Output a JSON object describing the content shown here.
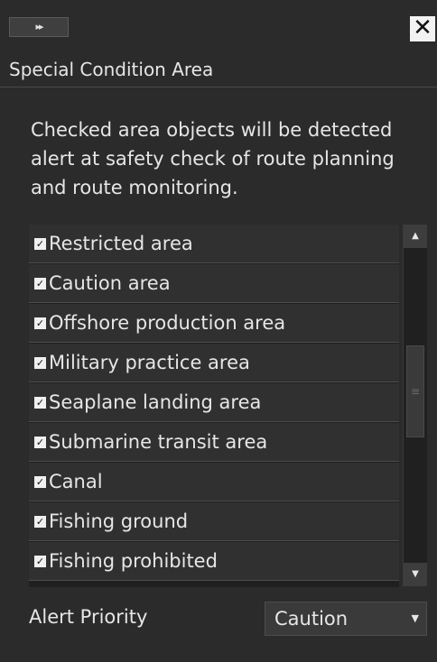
{
  "window": {
    "expand_icon": "double-chevron-right-icon",
    "expand_glyph": "▸▸",
    "close_icon": "close-icon",
    "close_glyph": "✕"
  },
  "panel": {
    "title": "Special Condition Area",
    "description": "Checked area objects will be detected alert at safety check of route planning and route monitoring."
  },
  "areas": [
    {
      "label": "Restricted area",
      "checked": true
    },
    {
      "label": "Caution area",
      "checked": true
    },
    {
      "label": "Offshore production area",
      "checked": true
    },
    {
      "label": "Military practice area",
      "checked": true
    },
    {
      "label": "Seaplane landing area",
      "checked": true
    },
    {
      "label": "Submarine transit area",
      "checked": true
    },
    {
      "label": "Canal",
      "checked": true
    },
    {
      "label": "Fishing ground",
      "checked": true
    },
    {
      "label": "Fishing prohibited",
      "checked": true
    }
  ],
  "checkbox_glyph": "✓",
  "scrollbar": {
    "up_glyph": "▲",
    "down_glyph": "▼",
    "thumb_glyph": "≡"
  },
  "alert_priority": {
    "label": "Alert Priority",
    "value": "Caution",
    "arrow_glyph": "▼"
  },
  "colors": {
    "background": "#2b2b2b",
    "row": "#303030",
    "text": "#e6e6e6"
  }
}
